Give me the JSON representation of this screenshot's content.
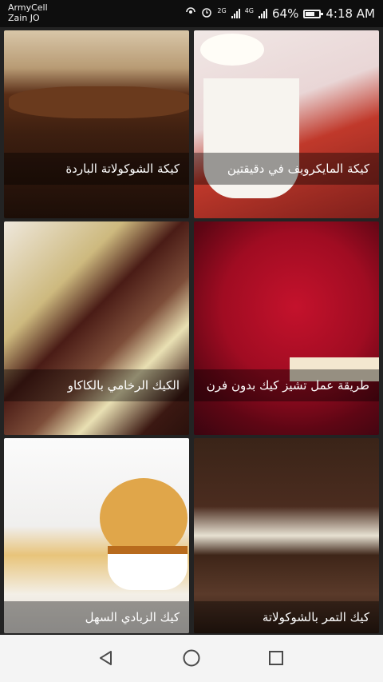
{
  "status_bar": {
    "carrier_1": "ArmyCell",
    "carrier_2": "Zain JO",
    "network_2g": "2G",
    "network_4g": "4G",
    "battery": "64%",
    "time": "4:18 AM"
  },
  "recipes": [
    {
      "title": "كيكة الشوكولاتة الباردة"
    },
    {
      "title": "كيكة المايكرويف في دقيقتين"
    },
    {
      "title": "الكيك الرخامي بالكاكاو"
    },
    {
      "title": "طريقة عمل تشيز كيك بدون فرن"
    },
    {
      "title": "كيك الزبادي السهل"
    },
    {
      "title": "كيك التمر بالشوكولاتة"
    }
  ],
  "nav_icons": [
    "back-triangle-icon",
    "home-circle-icon",
    "recents-square-icon"
  ]
}
